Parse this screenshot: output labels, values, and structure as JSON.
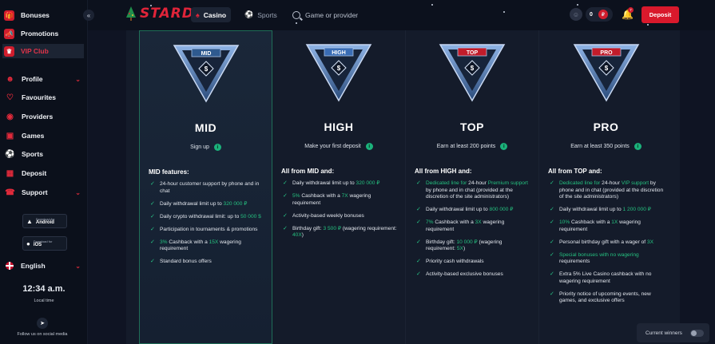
{
  "sidebar": {
    "items": [
      {
        "label": "Bonuses",
        "icon": "gift-icon"
      },
      {
        "label": "Promotions",
        "icon": "megaphone-icon"
      },
      {
        "label": "VIP Club",
        "icon": "crown-icon"
      }
    ],
    "nav": [
      {
        "label": "Profile",
        "icon": "user-icon",
        "chevron": true
      },
      {
        "label": "Favourites",
        "icon": "heart-icon",
        "chevron": false
      },
      {
        "label": "Providers",
        "icon": "chip-icon",
        "chevron": false
      },
      {
        "label": "Games",
        "icon": "gamepad-icon",
        "chevron": false
      },
      {
        "label": "Sports",
        "icon": "ball-icon",
        "chevron": false
      },
      {
        "label": "Deposit",
        "icon": "wallet-icon",
        "chevron": false
      },
      {
        "label": "Support",
        "icon": "headset-icon",
        "chevron": true
      }
    ],
    "android": {
      "small": "Download for",
      "big": "Android"
    },
    "ios": {
      "small": "Download for",
      "big": "iOS"
    },
    "language": "English",
    "time": "12:34 a.m.",
    "time_label": "Local time",
    "social_text": "Follow us on social media"
  },
  "header": {
    "logo": "STARDA",
    "tab_casino": "Casino",
    "tab_sports": "Sports",
    "search_placeholder": "Game or provider",
    "balance": "0",
    "currency": "₽",
    "notification_count": "7",
    "deposit_label": "Deposit"
  },
  "tiers": [
    {
      "badge": "MID",
      "name": "MID",
      "requirement": "Sign up",
      "features_title": "MID features:",
      "features": [
        [
          {
            "t": "24-hour customer support by phone and in chat"
          }
        ],
        [
          {
            "t": "Daily withdrawal limit up to "
          },
          {
            "t": "320 000 ₽",
            "g": true
          }
        ],
        [
          {
            "t": "Daily crypto withdrawal limit: up to "
          },
          {
            "t": "50 000 $",
            "g": true
          }
        ],
        [
          {
            "t": "Participation in tournaments & promotions"
          }
        ],
        [
          {
            "t": "3%",
            "g": true
          },
          {
            "t": " Cashback with a "
          },
          {
            "t": "15X",
            "g": true
          },
          {
            "t": " wagering requirement"
          }
        ],
        [
          {
            "t": "Standard bonus offers"
          }
        ]
      ]
    },
    {
      "badge": "HIGH",
      "name": "HIGH",
      "requirement": "Make your first deposit",
      "features_title": "All from MID and:",
      "features": [
        [
          {
            "t": "Daily withdrawal limit up to "
          },
          {
            "t": "320 000 ₽",
            "g": true
          }
        ],
        [
          {
            "t": "5%",
            "g": true
          },
          {
            "t": " Cashback with a "
          },
          {
            "t": "7X",
            "g": true
          },
          {
            "t": " wagering requirement"
          }
        ],
        [
          {
            "t": "Activity-based weekly bonuses"
          }
        ],
        [
          {
            "t": "Birthday gift: "
          },
          {
            "t": "3 500 ₽",
            "g": true
          },
          {
            "t": " (wagering requirement: "
          },
          {
            "t": "40X",
            "g": true
          },
          {
            "t": ")"
          }
        ]
      ]
    },
    {
      "badge": "TOP",
      "name": "TOP",
      "requirement": "Earn at least 200 points",
      "features_title": "All from HIGH and:",
      "features": [
        [
          {
            "t": "Dedicated line for",
            "g": true
          },
          {
            "t": " 24-hour "
          },
          {
            "t": "Premium support",
            "g": true
          },
          {
            "t": " by phone and in chat (provided at the discretion of the site administrators)"
          }
        ],
        [
          {
            "t": "Daily withdrawal limit up to "
          },
          {
            "t": "800 000 ₽",
            "g": true
          }
        ],
        [
          {
            "t": "7%",
            "g": true
          },
          {
            "t": " Cashback with a "
          },
          {
            "t": "3X",
            "g": true
          },
          {
            "t": " wagering requirement"
          }
        ],
        [
          {
            "t": "Birthday gift: "
          },
          {
            "t": "10 000 ₽",
            "g": true
          },
          {
            "t": " (wagering requirement: "
          },
          {
            "t": "5X",
            "g": true
          },
          {
            "t": ")"
          }
        ],
        [
          {
            "t": "Priority cash withdrawals"
          }
        ],
        [
          {
            "t": "Activity-based exclusive bonuses"
          }
        ]
      ]
    },
    {
      "badge": "PRO",
      "name": "PRO",
      "requirement": "Earn at least 350 points",
      "features_title": "All from TOP and:",
      "features": [
        [
          {
            "t": "Dedicated line for",
            "g": true
          },
          {
            "t": " 24-hour "
          },
          {
            "t": "VIP support",
            "g": true
          },
          {
            "t": " by phone and in chat (provided at the discretion of the site administrators)"
          }
        ],
        [
          {
            "t": "Daily withdrawal limit up to "
          },
          {
            "t": "1 200 000 ₽",
            "g": true
          }
        ],
        [
          {
            "t": "10%",
            "g": true
          },
          {
            "t": " Cashback with a "
          },
          {
            "t": "1X",
            "g": true
          },
          {
            "t": " wagering requirement"
          }
        ],
        [
          {
            "t": "Personal birthday gift with a wager of "
          },
          {
            "t": "3X",
            "g": true
          }
        ],
        [
          {
            "t": "Special bonuses with no wagering",
            "g": true
          },
          {
            "t": " requirements"
          }
        ],
        [
          {
            "t": "Extra 5% Live Casino cashback with no wagering requirement"
          }
        ],
        [
          {
            "t": "Priority notice of upcoming events, new games, and exclusive offers"
          }
        ]
      ]
    }
  ],
  "winners": {
    "label": "Current winners",
    "enabled": false
  },
  "colors": {
    "accent": "#d9192c",
    "highlight": "#25c07f",
    "background": "#0f1423"
  }
}
